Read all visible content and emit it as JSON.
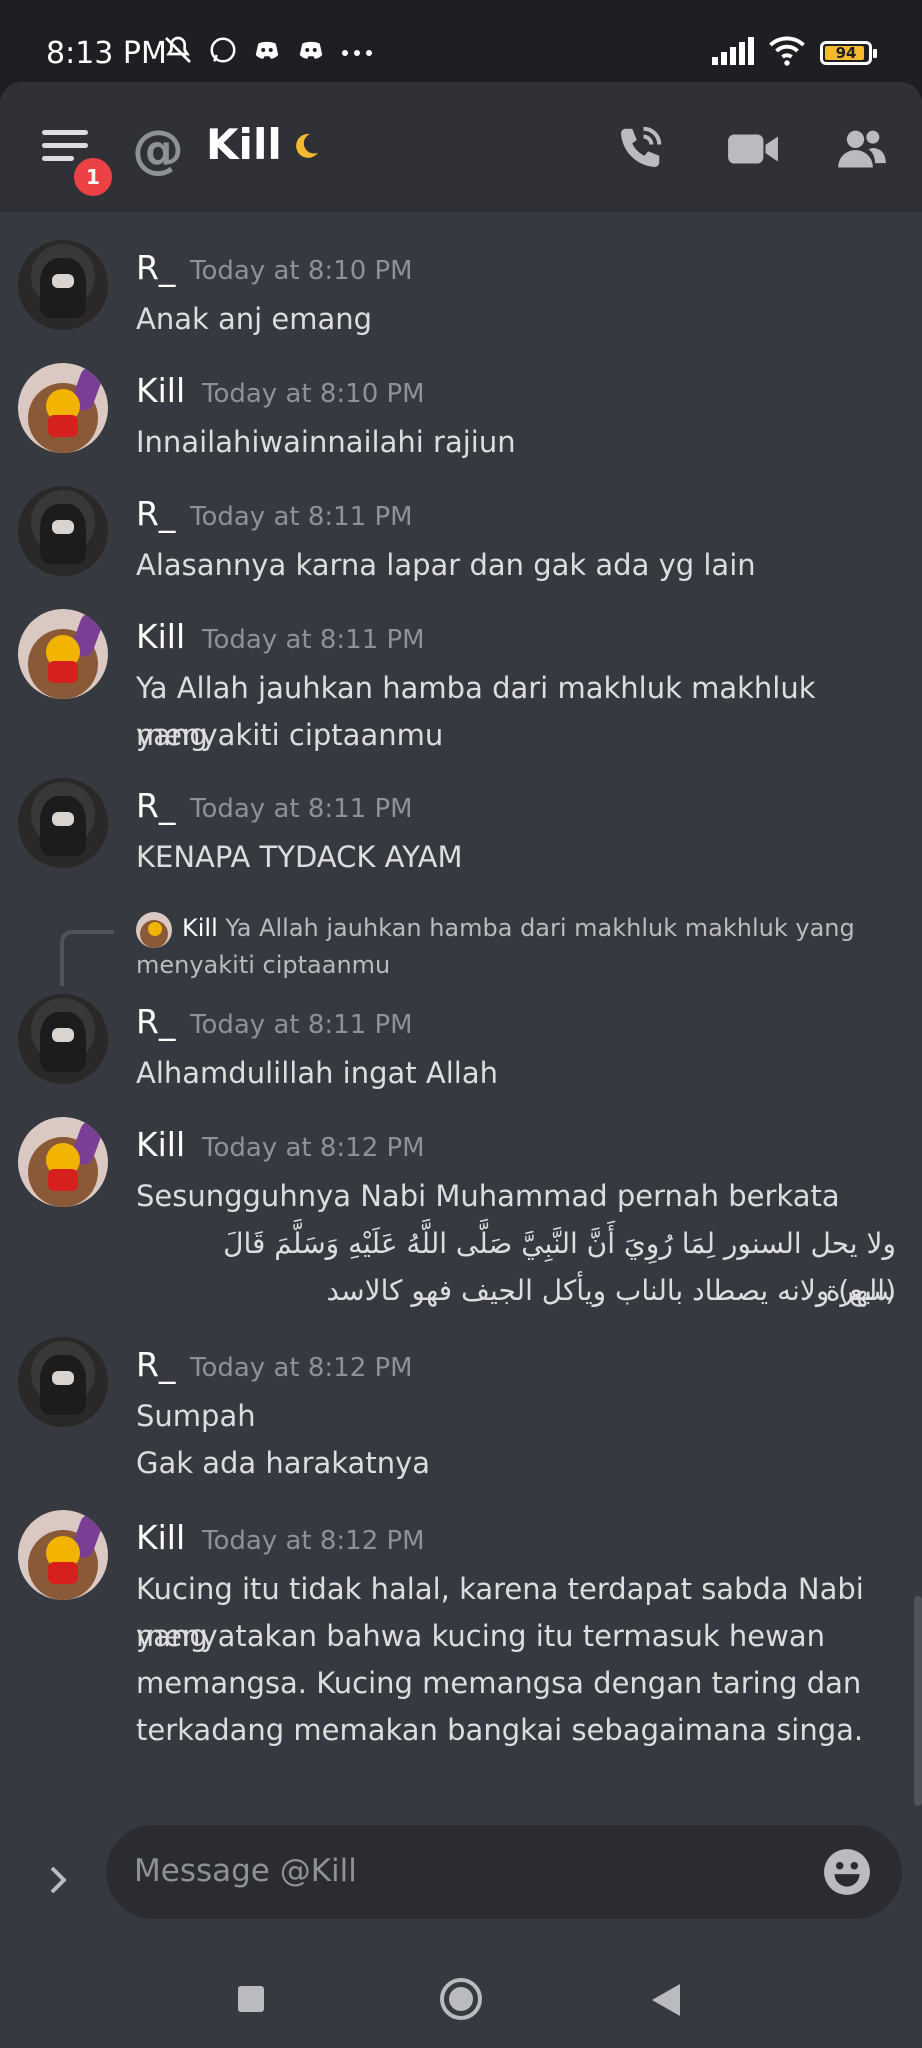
{
  "status_bar": {
    "time": "8:13 PM",
    "battery": "94",
    "icons": [
      "mute-icon",
      "whatsapp-icon",
      "discord-icon",
      "discord-icon",
      "more-icon",
      "signal-icon",
      "wifi-icon",
      "battery-icon"
    ]
  },
  "header": {
    "title": "Kill",
    "badge": "1",
    "status_emoji": "moon-icon"
  },
  "messages": [
    {
      "author": "R_",
      "time": "Today at 8:10 PM",
      "lines": [
        "Anak anj emang"
      ]
    },
    {
      "author": "Kill",
      "time": "Today at 8:10 PM",
      "lines": [
        "Innailahiwainnailahi rajiun"
      ]
    },
    {
      "author": "R_",
      "time": "Today at 8:11 PM",
      "lines": [
        "Alasannya karna lapar dan gak ada yg lain"
      ]
    },
    {
      "author": "Kill",
      "time": "Today at 8:11 PM",
      "lines": [
        "Ya Allah jauhkan hamba dari makhluk makhluk yang",
        "menyakiti ciptaanmu"
      ]
    },
    {
      "author": "R_",
      "time": "Today at 8:11 PM",
      "lines": [
        "KENAPA TYDACK AYAM"
      ]
    },
    {
      "author": "R_",
      "time": "Today at 8:11 PM",
      "lines": [
        "Alhamdulillah ingat Allah"
      ]
    },
    {
      "author": "Kill",
      "time": "Today at 8:12 PM",
      "lines": [
        "Sesungguhnya Nabi Muhammad pernah berkata"
      ],
      "arabic": [
        "ولا يحل السنور لِمَا رُوِيَ أَنَّ النَّبِيَّ صَلَّى اللَّهُ عَلَيْهِ وَسَلَّمَ قَالَ (الهرة",
        "سبع) ولانه يصطاد بالناب ويأكل الجيف فهو كالاسد"
      ]
    },
    {
      "author": "R_",
      "time": "Today at 8:12 PM",
      "lines": [
        "Sumpah",
        "Gak ada harakatnya"
      ]
    },
    {
      "author": "Kill",
      "time": "Today at 8:12 PM",
      "lines": [
        "Kucing itu tidak halal, karena terdapat sabda Nabi yang",
        "menyatakan bahwa kucing itu termasuk hewan",
        "memangsa. Kucing memangsa dengan taring dan",
        "terkadang memakan bangkai sebagaimana singa."
      ]
    }
  ],
  "reply": {
    "author": "Kill",
    "text": "Ya Allah jauhkan hamba dari makhluk makhluk yang menyakiti ciptaanmu"
  },
  "composer": {
    "placeholder": "Message @Kill"
  },
  "colors": {
    "background": "#36393f",
    "header": "#2f3136",
    "badge": "#ed4245",
    "moon": "#f5b82e"
  }
}
